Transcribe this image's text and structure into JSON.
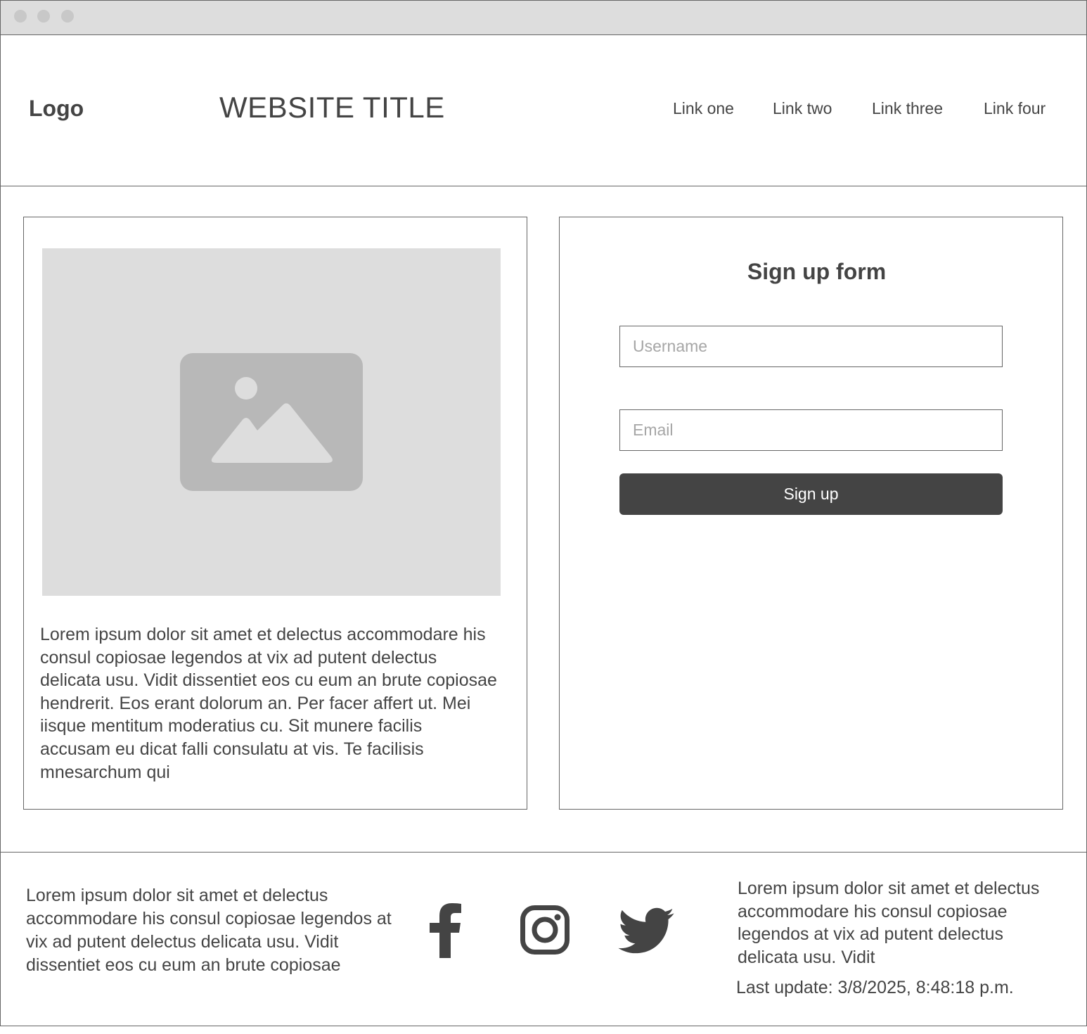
{
  "window": {
    "controls": [
      "close",
      "minimize",
      "maximize"
    ]
  },
  "header": {
    "logo": "Logo",
    "title": "WEBSITE TITLE",
    "nav": [
      {
        "label": "Link one"
      },
      {
        "label": "Link two"
      },
      {
        "label": "Link three"
      },
      {
        "label": "Link four"
      }
    ]
  },
  "content": {
    "image_icon": "image-icon",
    "paragraph": "Lorem ipsum dolor sit amet et delectus accommodare his consul copiosae legendos at vix ad putent delectus delicata usu. Vidit dissentiet eos cu eum an brute copiosae hendrerit. Eos erant dolorum an. Per facer affert ut. Mei iisque mentitum moderatius cu. Sit munere facilis accusam eu dicat falli consulatu at vis. Te facilisis mnesarchum qui"
  },
  "signup_form": {
    "title": "Sign up form",
    "username_placeholder": "Username",
    "username_value": "",
    "email_placeholder": "Email",
    "email_value": "",
    "button_label": "Sign up"
  },
  "footer": {
    "left_text": "Lorem ipsum dolor sit amet et delectus accommodare his consul copiosae legendos at vix ad putent delectus delicata usu. Vidit dissentiet eos cu eum an brute copiosae",
    "social": [
      {
        "icon": "facebook-icon"
      },
      {
        "icon": "instagram-icon"
      },
      {
        "icon": "twitter-icon"
      }
    ],
    "right_text": "Lorem ipsum dolor sit amet et delectus accommodare his consul copiosae legendos at vix ad putent delectus delicata usu. Vidit",
    "last_update": "Last update: 3/8/2025, 8:48:18 p.m."
  },
  "colors": {
    "text": "#444444",
    "border": "#666666",
    "placeholder_bg": "#dddddd",
    "placeholder_icon": "#b8b8b8",
    "button_bg": "#444444",
    "button_text": "#ffffff"
  }
}
